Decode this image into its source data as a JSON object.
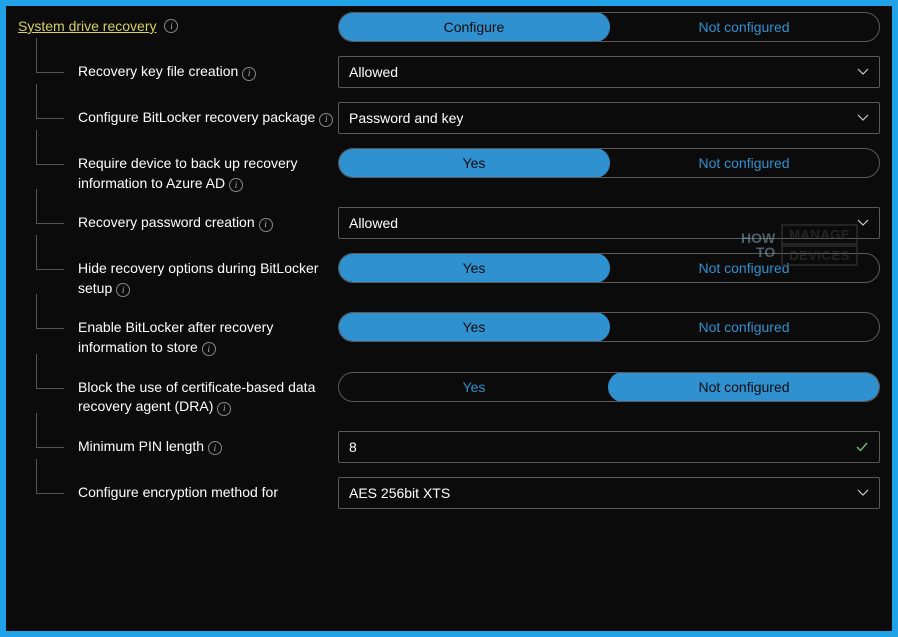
{
  "section": {
    "title": "System drive recovery",
    "toggle": {
      "left": "Configure",
      "right": "Not configured",
      "selected": "left"
    }
  },
  "rows": [
    {
      "label": "Recovery key file creation",
      "type": "select",
      "value": "Allowed"
    },
    {
      "label": "Configure BitLocker recovery package",
      "type": "select",
      "value": "Password and key"
    },
    {
      "label": "Require device to back up recovery information to Azure AD",
      "type": "toggle",
      "left": "Yes",
      "right": "Not configured",
      "selected": "left"
    },
    {
      "label": "Recovery password creation",
      "type": "select",
      "value": "Allowed"
    },
    {
      "label": "Hide recovery options during BitLocker setup",
      "type": "toggle",
      "left": "Yes",
      "right": "Not configured",
      "selected": "left"
    },
    {
      "label": "Enable BitLocker after recovery information to store",
      "type": "toggle",
      "left": "Yes",
      "right": "Not configured",
      "selected": "left"
    },
    {
      "label": "Block the use of certificate-based data recovery agent (DRA)",
      "type": "toggle",
      "left": "Yes",
      "right": "Not configured",
      "selected": "right"
    },
    {
      "label": "Minimum PIN length",
      "type": "input",
      "value": "8"
    },
    {
      "label": "Configure encryption method for",
      "type": "select",
      "value": "AES 256bit XTS"
    }
  ],
  "watermark": {
    "line1": "HOW",
    "line2": "TO",
    "box1": "MANAGE",
    "box2": "DEVICES"
  }
}
